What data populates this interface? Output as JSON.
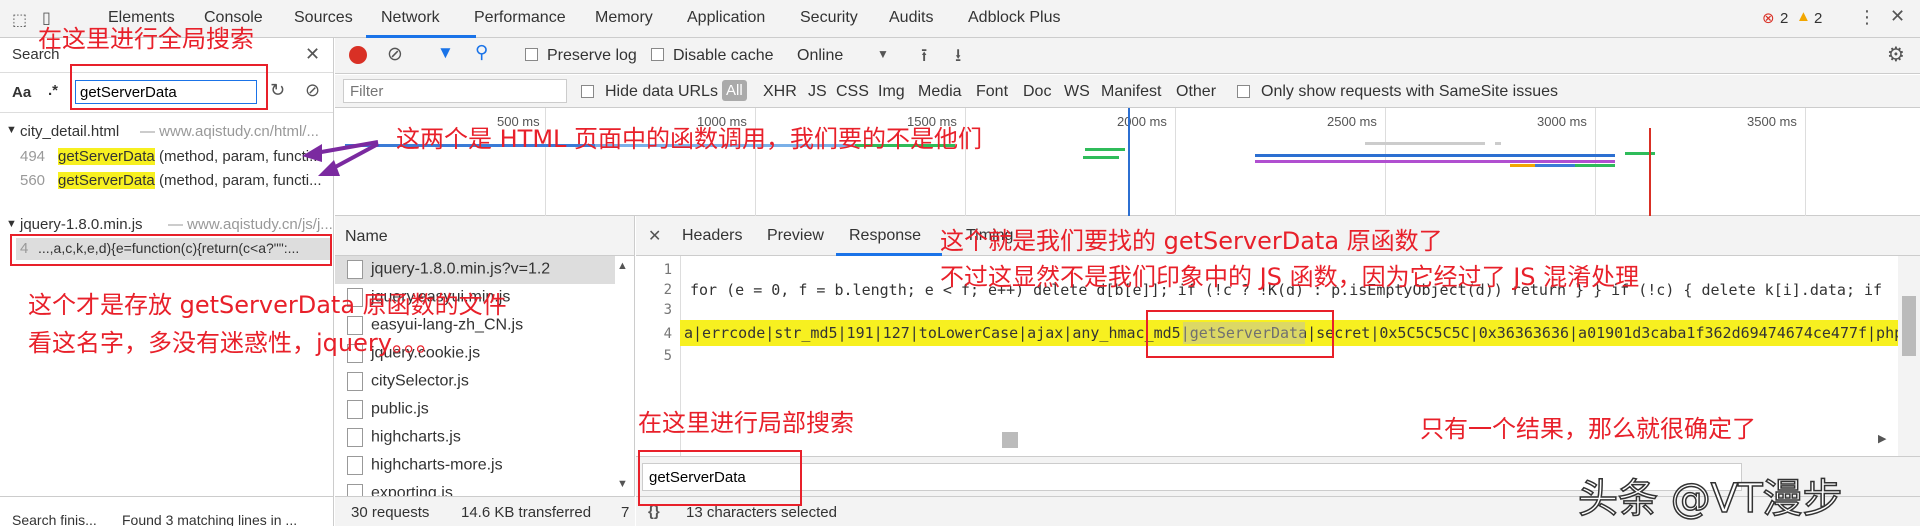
{
  "topbar": {
    "tabs": [
      "Elements",
      "Console",
      "Sources",
      "Network",
      "Performance",
      "Memory",
      "Application",
      "Security",
      "Audits",
      "Adblock Plus"
    ],
    "errors": "2",
    "warnings": "2"
  },
  "search_panel": {
    "title": "Search",
    "case_label": "Aa",
    "regex_label": ".*",
    "query": "getServerData",
    "result_file_1": "city_detail.html",
    "result_file_1_url": "— www.aqistudy.cn/html/...",
    "results_1": [
      {
        "line": "494",
        "match": "getServerData",
        "rest": "(method, param, functi..."
      },
      {
        "line": "560",
        "match": "getServerData",
        "rest": "(method, param, functi..."
      }
    ],
    "result_file_2": "jquery-1.8.0.min.js",
    "result_file_2_url": "— www.aqistudy.cn/js/j...",
    "results_2": [
      {
        "line": "4",
        "text": "...,a,c,k,e,d){e=function(c){return(c<a?\"\":..."
      }
    ],
    "status_left": "Search finis...",
    "status_right": "Found 3 matching lines in ..."
  },
  "toolbar": {
    "preserve_log": "Preserve log",
    "disable_cache": "Disable cache",
    "throttle": "Online"
  },
  "filterbar": {
    "placeholder": "Filter",
    "hide_data_urls": "Hide data URLs",
    "types": [
      "All",
      "XHR",
      "JS",
      "CSS",
      "Img",
      "Media",
      "Font",
      "Doc",
      "WS",
      "Manifest",
      "Other"
    ],
    "samesite": "Only show requests with SameSite issues"
  },
  "timeline": {
    "ticks": [
      "500 ms",
      "1000 ms",
      "1500 ms",
      "2000 ms",
      "2500 ms",
      "3000 ms",
      "3500 ms"
    ]
  },
  "namelist": {
    "header": "Name",
    "files": [
      "jquery-1.8.0.min.js?v=1.2",
      "jquery.easyui.min.js",
      "easyui-lang-zh_CN.js",
      "jquery.cookie.js",
      "citySelector.js",
      "public.js",
      "highcharts.js",
      "highcharts-more.js",
      "exporting.js"
    ],
    "requests": "30 requests",
    "transferred": "14.6 KB transferred",
    "trailing": "7"
  },
  "response": {
    "tabs": [
      "Headers",
      "Preview",
      "Response",
      "Timing"
    ],
    "line_numbers": [
      "1",
      "2",
      "3",
      "4",
      "5"
    ],
    "line2": "for (e = 0, f = b.length; e < f; e++) delete d[b[e]]; if (!c ? !K(d) : p.isEmptyObject(d)) return } } if (!c) { delete k[i].data; if (!K(k",
    "line4": "a|errcode|str_md5|191|127|toLowerCase|ajax|any_hmac_md5|getServerData|secret|0x5C5C5C5C|0x36363636|a01901d3caba1f362d69474674ce477f|php|",
    "search_query": "getServerData",
    "selected": "13 characters selected",
    "braces": "{}"
  },
  "annotations": {
    "global_search": "在这里进行全局搜索",
    "html_calls": "这两个是 HTML 页面中的函数调用，我们要的不是他们",
    "original_fn_1": "这个就是我们要找的 getServerData 原函数了",
    "original_fn_2": "不过这显然不是我们印象中的 JS 函数，因为它经过了 JS 混淆处理",
    "file_note_1": "这个才是存放 getServerData 原函数的文件",
    "file_note_2": "看这名字，多没有迷惑性，jquery。。。",
    "local_search": "在这里进行局部搜索",
    "one_result": "只有一个结果，那么就很确定了",
    "watermark": "头条 @VT漫步"
  }
}
